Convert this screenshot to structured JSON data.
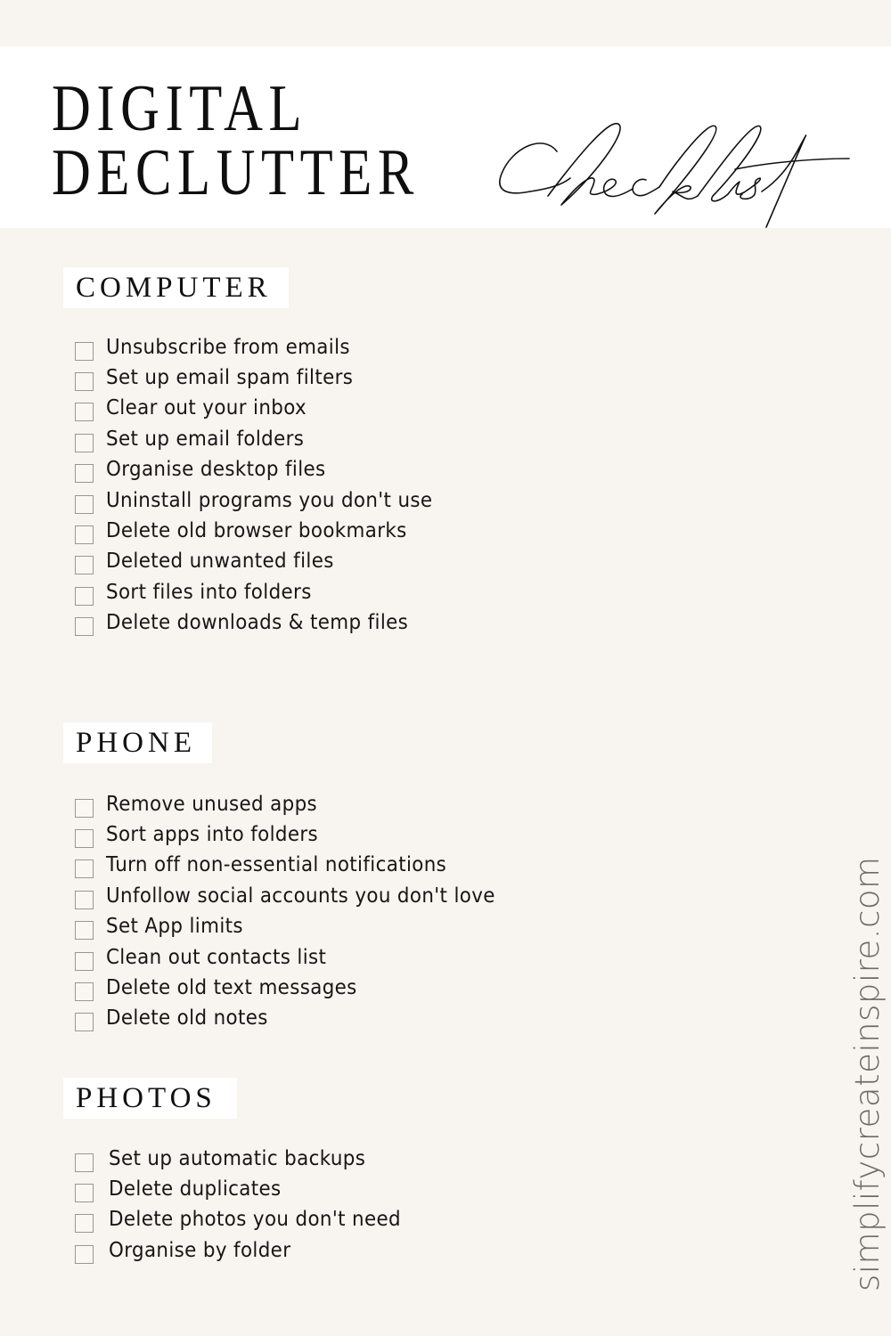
{
  "header": {
    "title_line_1": "DIGITAL",
    "title_line_2": "DECLUTTER",
    "script_word": "Checklist"
  },
  "sections": [
    {
      "label": "COMPUTER",
      "items": [
        {
          "text": "Unsubscribe from emails",
          "checked": false
        },
        {
          "text": "Set up email spam filters",
          "checked": false
        },
        {
          "text": "Clear out your inbox",
          "checked": false
        },
        {
          "text": "Set up email folders",
          "checked": false
        },
        {
          "text": "Organise desktop files",
          "checked": false
        },
        {
          "text": "Uninstall programs you don't use",
          "checked": false
        },
        {
          "text": "Delete old browser bookmarks",
          "checked": false
        },
        {
          "text": "Deleted unwanted files",
          "checked": false
        },
        {
          "text": "Sort files into folders",
          "checked": false
        },
        {
          "text": "Delete downloads & temp files",
          "checked": false
        }
      ]
    },
    {
      "label": "PHONE",
      "items": [
        {
          "text": "Remove unused apps",
          "checked": false
        },
        {
          "text": "Sort apps into folders",
          "checked": false
        },
        {
          "text": "Turn off non-essential notifications",
          "checked": false
        },
        {
          "text": "Unfollow social accounts you don't love",
          "checked": false
        },
        {
          "text": "Set App limits",
          "checked": false
        },
        {
          "text": "Clean out contacts list",
          "checked": false
        },
        {
          "text": "Delete old text messages",
          "checked": false
        },
        {
          "text": "Delete old notes",
          "checked": false
        }
      ]
    },
    {
      "label": "PHOTOS",
      "items": [
        {
          "text": "Set up automatic backups",
          "checked": false
        },
        {
          "text": "Delete duplicates",
          "checked": false
        },
        {
          "text": "Delete photos you don't need",
          "checked": false
        },
        {
          "text": "Organise by folder",
          "checked": false
        }
      ]
    }
  ],
  "watermark": "simplifycreateinspire.com",
  "colors": {
    "background": "#f8f4ef",
    "panel": "#ffffff",
    "text": "#141414",
    "checkbox_border": "#9a9690",
    "watermark": "#6e6b67"
  }
}
